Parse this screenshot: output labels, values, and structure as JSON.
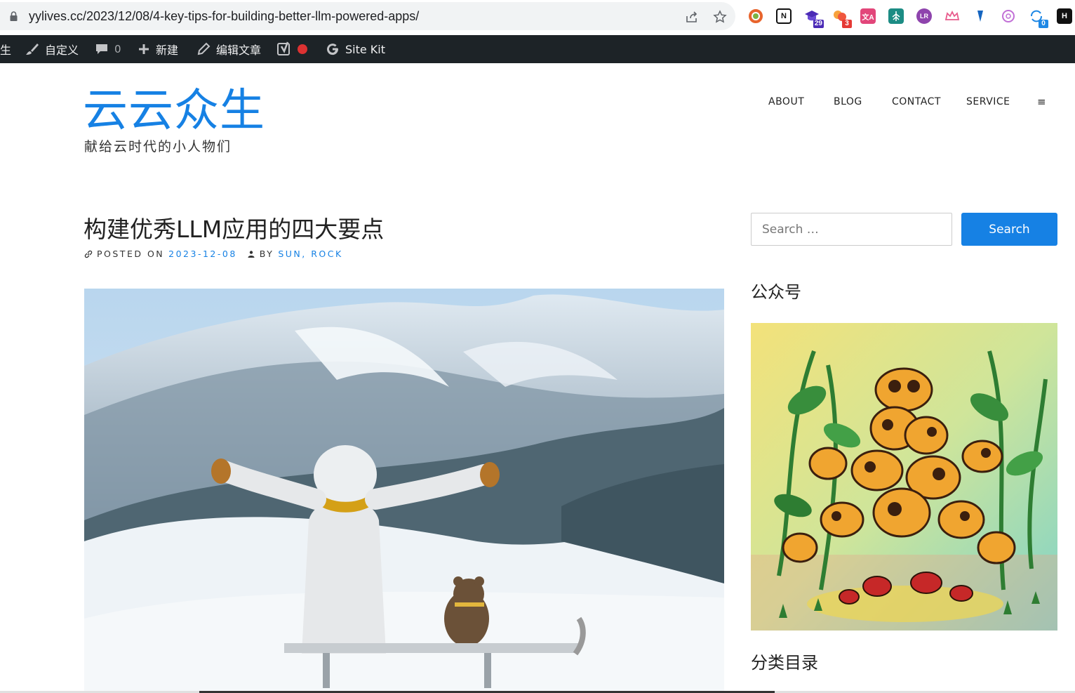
{
  "browser": {
    "url": "yylives.cc/2023/12/08/4-key-tips-for-building-better-llm-powered-apps/",
    "extensions": [
      {
        "name": "chrome-extension-orange-ring",
        "color": "#e8642c"
      },
      {
        "name": "notion-icon",
        "color": "#111111",
        "label": "N"
      },
      {
        "name": "graduation-cap-icon",
        "color": "#4b2bb6",
        "badge": "29",
        "badge_color": "#4b2bb6"
      },
      {
        "name": "pills-icon",
        "color": "#f0563d",
        "badge": "3",
        "badge_color": "#e53935"
      },
      {
        "name": "translate-icon",
        "color": "#e2467a",
        "label": "文A"
      },
      {
        "name": "tree-icon",
        "color": "#1c8c84"
      },
      {
        "name": "lr-icon",
        "color": "#8e44ad",
        "label": "LR"
      },
      {
        "name": "crown-icon",
        "color": "#e85a8c"
      },
      {
        "name": "bookmark-blue-icon",
        "color": "#1565c0"
      },
      {
        "name": "openai-icon",
        "color": "#c16fd6"
      },
      {
        "name": "sync-icon",
        "color": "#1e88e5",
        "badge": "0",
        "badge_color": "#1e88e5"
      },
      {
        "name": "h-logo-icon",
        "color": "#111111",
        "label": "H"
      }
    ]
  },
  "adminbar": {
    "site_fragment": "生",
    "customize": "自定义",
    "comments_count": "0",
    "new": "新建",
    "edit": "编辑文章",
    "sitekit": "Site Kit"
  },
  "header": {
    "site_title": "云云众生",
    "tagline": "献给云时代的小人物们",
    "nav": [
      "ABOUT",
      "BLOG",
      "CONTACT",
      "SERVICE"
    ],
    "menu_symbol": "≡"
  },
  "post": {
    "title": "构建优秀LLM应用的四大要点",
    "posted_on_label": "POSTED ON",
    "date": "2023-12-08",
    "by_label": "BY",
    "authors": "SUN, ROCK"
  },
  "sidebar": {
    "search_placeholder": "Search …",
    "search_button": "Search",
    "widget_1_title": "公众号",
    "widget_2_title": "分类目录"
  },
  "colors": {
    "accent": "#1681e4",
    "adminbar": "#1d2327"
  }
}
